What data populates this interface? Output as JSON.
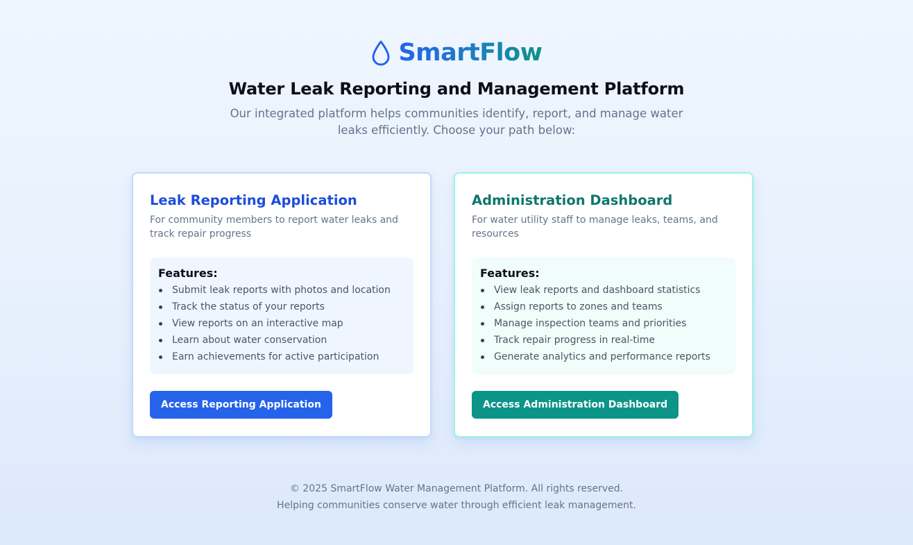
{
  "brand": {
    "name": "SmartFlow",
    "icon": "water-drop-icon",
    "gradient_start": "#2563eb",
    "gradient_end": "#0d9488"
  },
  "hero": {
    "title": "Water Leak Reporting and Management Platform",
    "subtitle": "Our integrated platform helps communities identify, report, and manage water leaks efficiently. Choose your path below:"
  },
  "cards": [
    {
      "title": "Leak Reporting Application",
      "description": "For community members to report water leaks and track repair progress",
      "features_title": "Features:",
      "features": [
        "Submit leak reports with photos and location",
        "Track the status of your reports",
        "View reports on an interactive map",
        "Learn about water conservation",
        "Earn achievements for active participation"
      ],
      "button_label": "Access Reporting Application",
      "accent": "#2563eb"
    },
    {
      "title": "Administration Dashboard",
      "description": "For water utility staff to manage leaks, teams, and resources",
      "features_title": "Features:",
      "features": [
        "View leak reports and dashboard statistics",
        "Assign reports to zones and teams",
        "Manage inspection teams and priorities",
        "Track repair progress in real-time",
        "Generate analytics and performance reports"
      ],
      "button_label": "Access Administration Dashboard",
      "accent": "#0d9488"
    }
  ],
  "footer": {
    "copyright": "© 2025 SmartFlow Water Management Platform. All rights reserved.",
    "tagline": "Helping communities conserve water through efficient leak management."
  }
}
